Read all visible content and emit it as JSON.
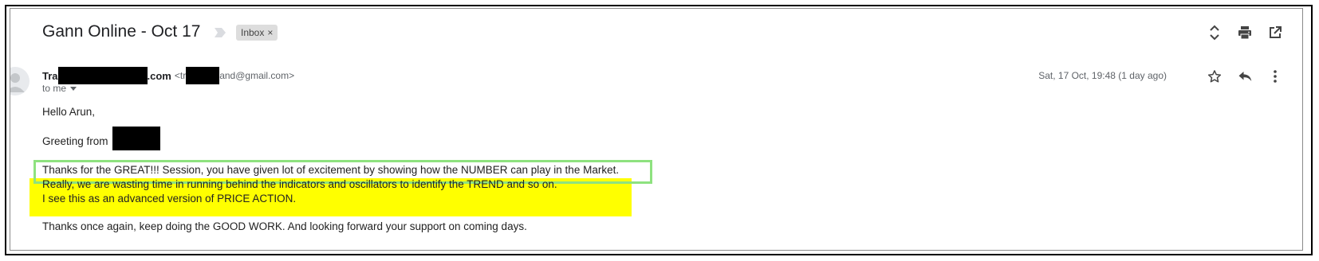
{
  "email": {
    "subject": "Gann Online - Oct 17",
    "label": "Inbox",
    "label_close": "×",
    "sender_name_start": "Tra",
    "sender_name_end": ".com",
    "sender_email_start": "<tr",
    "sender_email_end": "and@gmail.com>",
    "recipient": "to me",
    "date": "Sat, 17 Oct, 19:48 (1 day ago)",
    "body": {
      "greeting": "Hello Arun,",
      "greeting_from": "Greeting from",
      "line1": "Thanks for the GREAT!!! Session, you have given lot of excitement by showing how the NUMBER can play in the Market.",
      "line2": "Really, we are wasting time in running behind the indicators and oscillators to identify the TREND and so on.",
      "line3": "I see this as an advanced version of PRICE ACTION.",
      "line4": "Thanks once again, keep doing the GOOD WORK. And looking forward your support on coming days."
    }
  },
  "icons": {
    "importance": "importance-marker-icon",
    "expand": "expand-collapse-icon",
    "print": "print-icon",
    "open_new": "open-in-new-window-icon",
    "star": "star-icon",
    "reply": "reply-icon",
    "more": "more-options-icon",
    "avatar": "avatar-icon",
    "dropdown": "chevron-down-icon"
  },
  "colors": {
    "highlight_yellow": "#ffff00",
    "highlight_green": "#8ee27f",
    "redaction": "#000000",
    "label_chip_bg": "#dddddd"
  }
}
